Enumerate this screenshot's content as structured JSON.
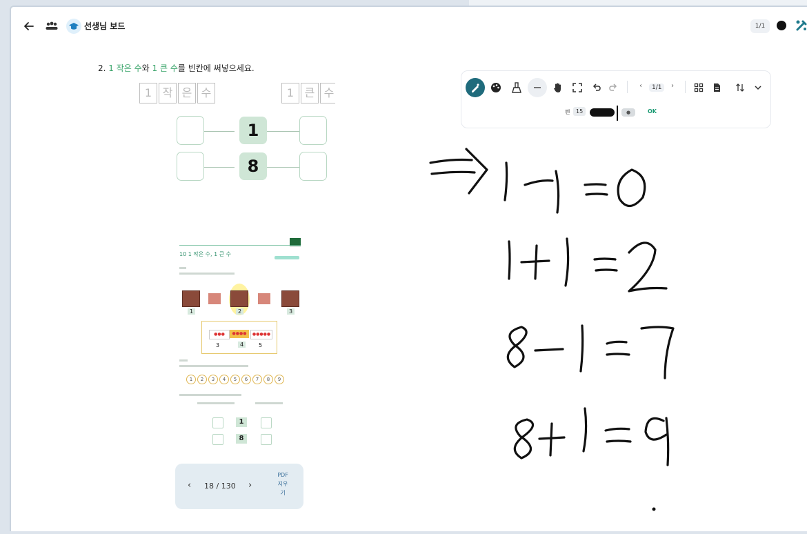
{
  "header": {
    "title": "선생님 보드",
    "page_indicator": "1/1",
    "icons": [
      "back-arrow-icon",
      "people-icon",
      "graduation-cap-icon",
      "pen-color-dot-icon",
      "tools-icon"
    ]
  },
  "worksheet": {
    "question_prefix": "2. ",
    "q_part1": "1 작은 수",
    "q_part2": "와 ",
    "q_part3": "1 큰 수",
    "q_part4": "를 빈칸에 써넣으세요.",
    "label_left": [
      "1",
      "작",
      "은",
      "수"
    ],
    "label_right": [
      "1",
      "큰",
      "수"
    ],
    "rows": [
      {
        "center": "1"
      },
      {
        "center": "8"
      }
    ]
  },
  "thumbnail": {
    "heading": "10 1 작은 수, 1 큰 수",
    "row1_numbers": [
      "1",
      "2",
      "3"
    ],
    "row2_numbers": [
      "3",
      "4",
      "5"
    ],
    "sequence": [
      "1",
      "2",
      "3",
      "4",
      "5",
      "6",
      "7",
      "8",
      "9"
    ],
    "mini_rows": [
      "1",
      "8"
    ]
  },
  "pager": {
    "prev": "‹",
    "next": "›",
    "page_text": "18 / 130",
    "pdf_label_1": "PDF",
    "pdf_label_2": "지우",
    "pdf_label_3": "기"
  },
  "toolbar": {
    "page_text": "1/1",
    "prev": "‹",
    "next": "›",
    "size_label": "펜",
    "size_value": "15",
    "ok_label": "OK",
    "accent_color": "#1f6b7c",
    "icons": [
      "pen-icon",
      "palette-icon",
      "eraser-icon",
      "line-icon",
      "hand-icon",
      "fullscreen-icon",
      "undo-icon",
      "redo-icon",
      "grid-icon",
      "document-icon",
      "sort-icon",
      "chevron-down-icon"
    ]
  }
}
